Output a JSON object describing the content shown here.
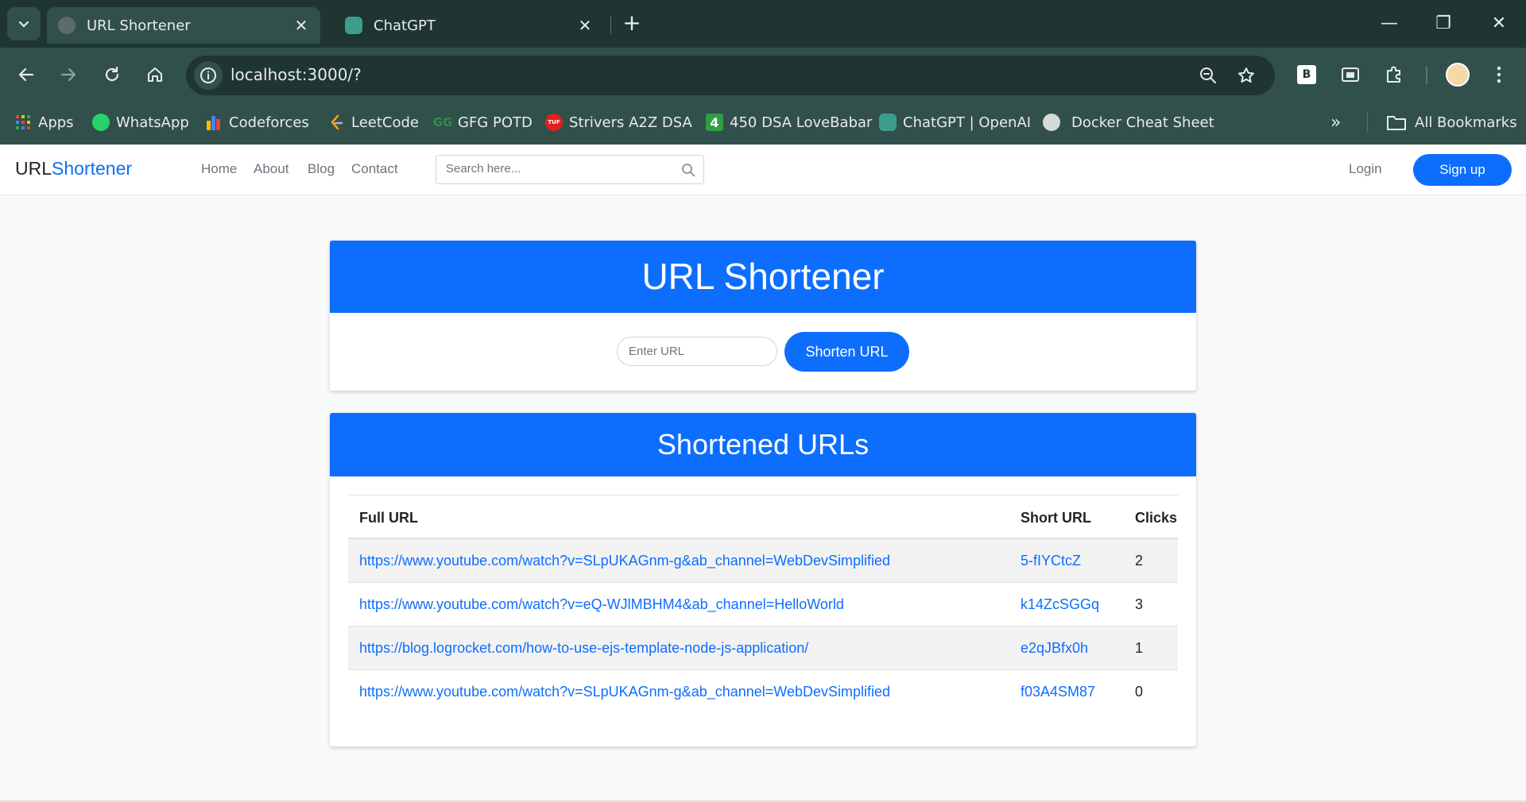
{
  "browser": {
    "tabs": [
      {
        "title": "URL Shortener",
        "active": true
      },
      {
        "title": "ChatGPT",
        "active": false
      }
    ],
    "address": "localhost:3000/?",
    "bookmarks": [
      {
        "label": "Apps",
        "icon": "apps-grid-icon"
      },
      {
        "label": "WhatsApp",
        "icon": "whatsapp-icon"
      },
      {
        "label": "Codeforces",
        "icon": "codeforces-icon"
      },
      {
        "label": "LeetCode",
        "icon": "leetcode-icon"
      },
      {
        "label": "GFG POTD",
        "icon": "gfg-icon"
      },
      {
        "label": "Strivers A2Z DSA",
        "icon": "tuf-icon"
      },
      {
        "label": "450 DSA LoveBabar",
        "icon": "four-icon"
      },
      {
        "label": "ChatGPT | OpenAI",
        "icon": "openai-icon"
      },
      {
        "label": "Docker Cheat Sheet",
        "icon": "globe-icon"
      }
    ],
    "all_bookmarks": "All Bookmarks",
    "extension_badge": "B"
  },
  "navbar": {
    "brand_plain": "URL",
    "brand_accent": "Shortener",
    "links": [
      "Home",
      "About",
      "Blog",
      "Contact"
    ],
    "search_placeholder": "Search here...",
    "login": "Login",
    "signup": "Sign up"
  },
  "shortener": {
    "title": "URL Shortener",
    "input_placeholder": "Enter URL",
    "button": "Shorten URL"
  },
  "list": {
    "title": "Shortened URLs",
    "headers": {
      "full": "Full URL",
      "short": "Short URL",
      "clicks": "Clicks"
    },
    "rows": [
      {
        "full": "https://www.youtube.com/watch?v=SLpUKAGnm-g&ab_channel=WebDevSimplified",
        "short": "5-fIYCtcZ",
        "clicks": "2"
      },
      {
        "full": "https://www.youtube.com/watch?v=eQ-WJlMBHM4&ab_channel=HelloWorld",
        "short": "k14ZcSGGq",
        "clicks": "3"
      },
      {
        "full": "https://blog.logrocket.com/how-to-use-ejs-template-node-js-application/",
        "short": "e2qJBfx0h",
        "clicks": "1"
      },
      {
        "full": "https://www.youtube.com/watch?v=SLpUKAGnm-g&ab_channel=WebDevSimplified",
        "short": "f03A4SM87",
        "clicks": "0"
      }
    ]
  },
  "colors": {
    "primary": "#0d6efd",
    "chrome_dark": "#1f3531",
    "chrome_mid": "#31504b"
  }
}
